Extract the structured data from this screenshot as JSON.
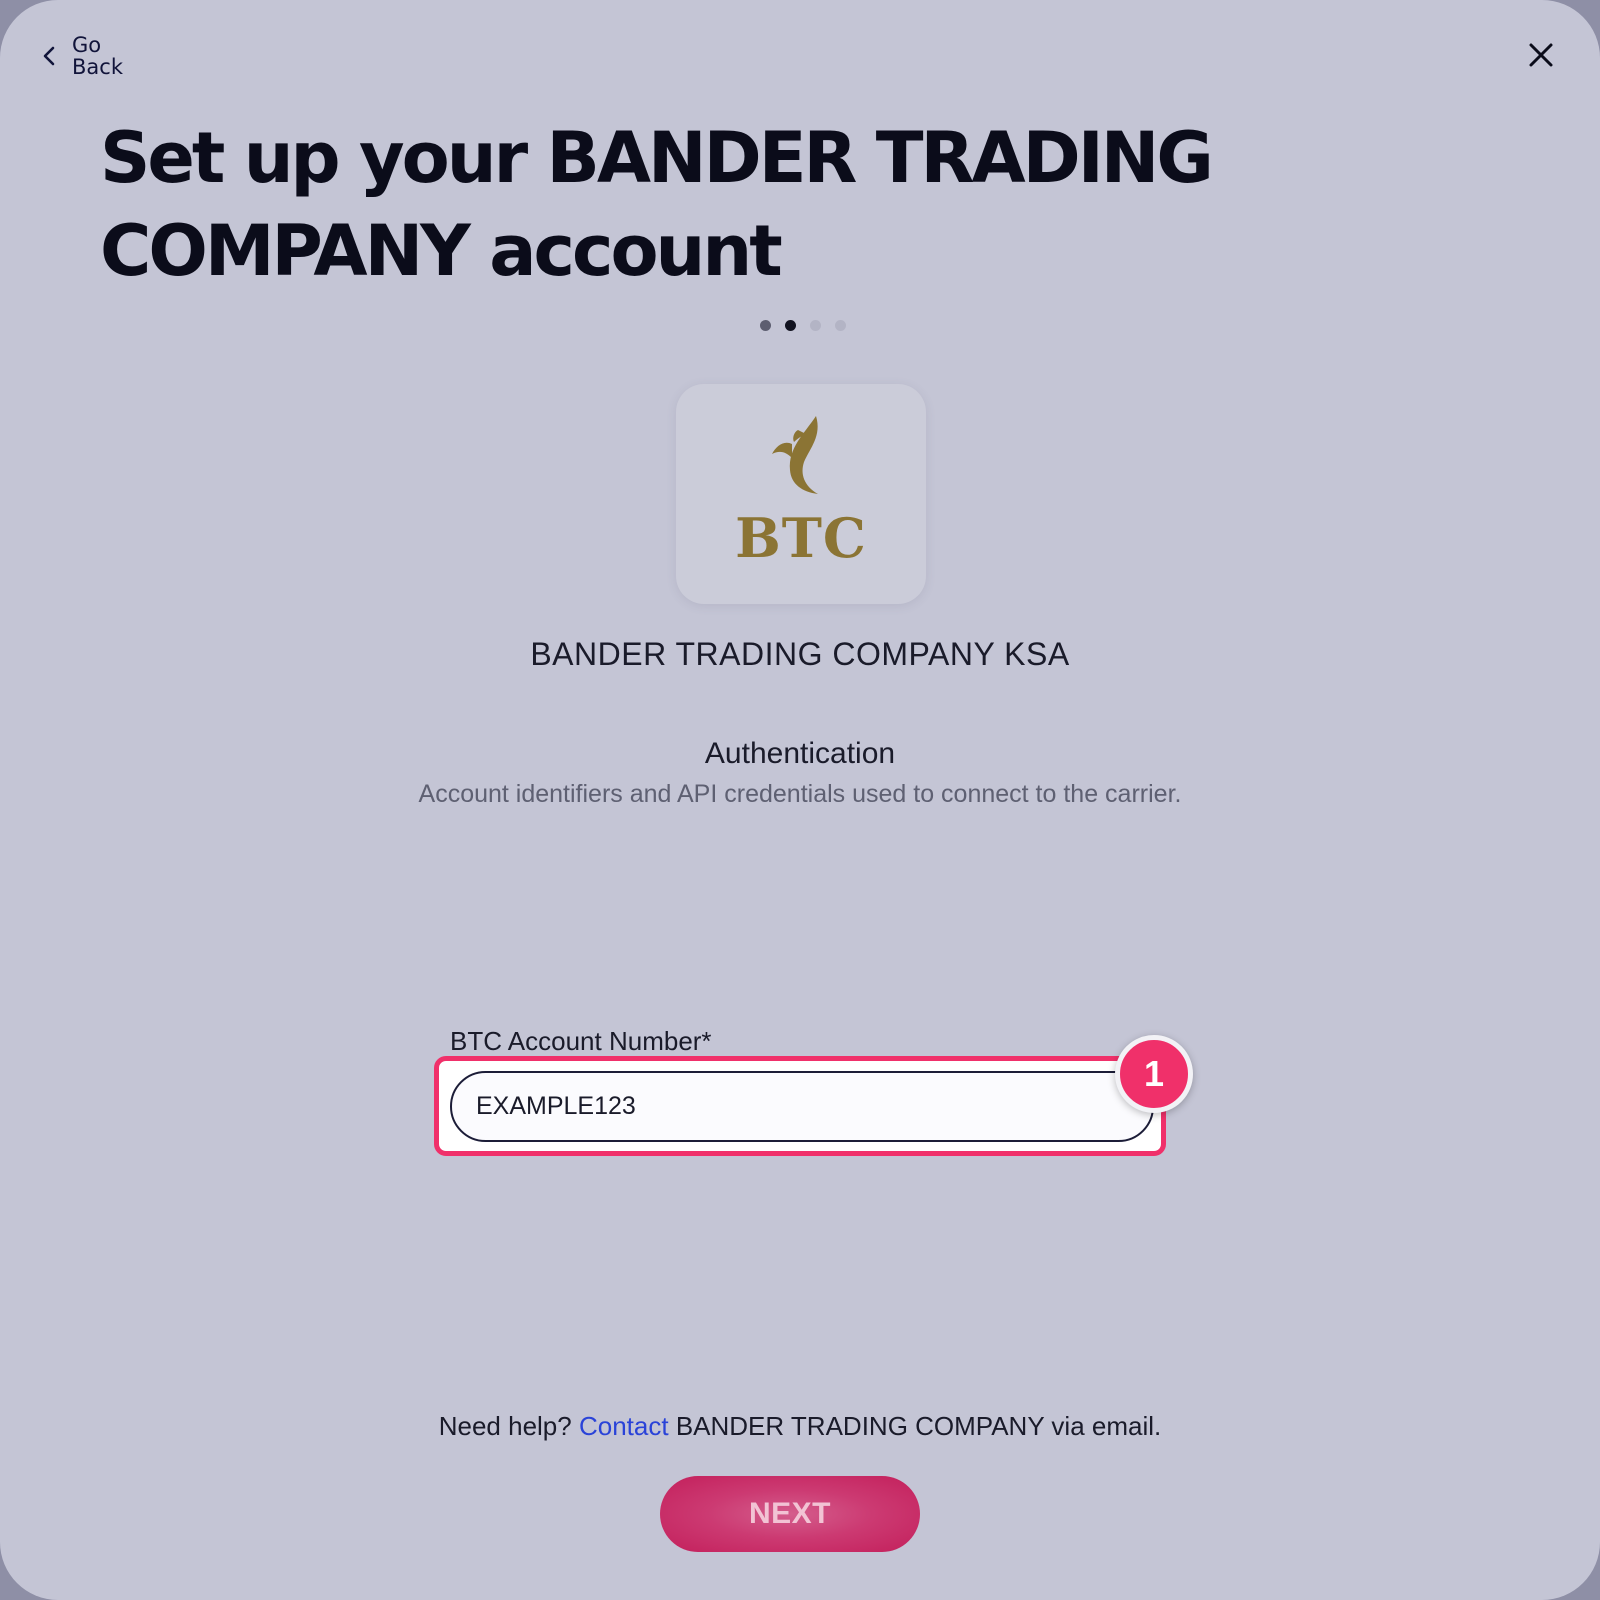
{
  "nav": {
    "back_label": "Go Back",
    "back_icon": "chevron-left-icon",
    "close_icon": "close-icon"
  },
  "headline": "Set up your BANDER TRADING COMPANY account",
  "progress": {
    "total_steps": 4,
    "current_step": 2
  },
  "carrier": {
    "logo_text": "BTC",
    "name": "BANDER TRADING COMPANY KSA"
  },
  "section": {
    "title": "Authentication",
    "description": "Account identifiers and API credentials used to connect to the carrier."
  },
  "form": {
    "account_number_label": "BTC Account Number*",
    "account_number_value": "EXAMPLE123"
  },
  "annotation": {
    "badge": "1"
  },
  "help": {
    "prefix": "Need help?",
    "link": "Contact",
    "suffix": "BANDER TRADING COMPANY via email."
  },
  "actions": {
    "next_label": "NEXT"
  },
  "colors": {
    "background": "#c4c5d5",
    "accent": "#f0306a",
    "button": "#c31f5b",
    "link": "#2a43d8"
  }
}
